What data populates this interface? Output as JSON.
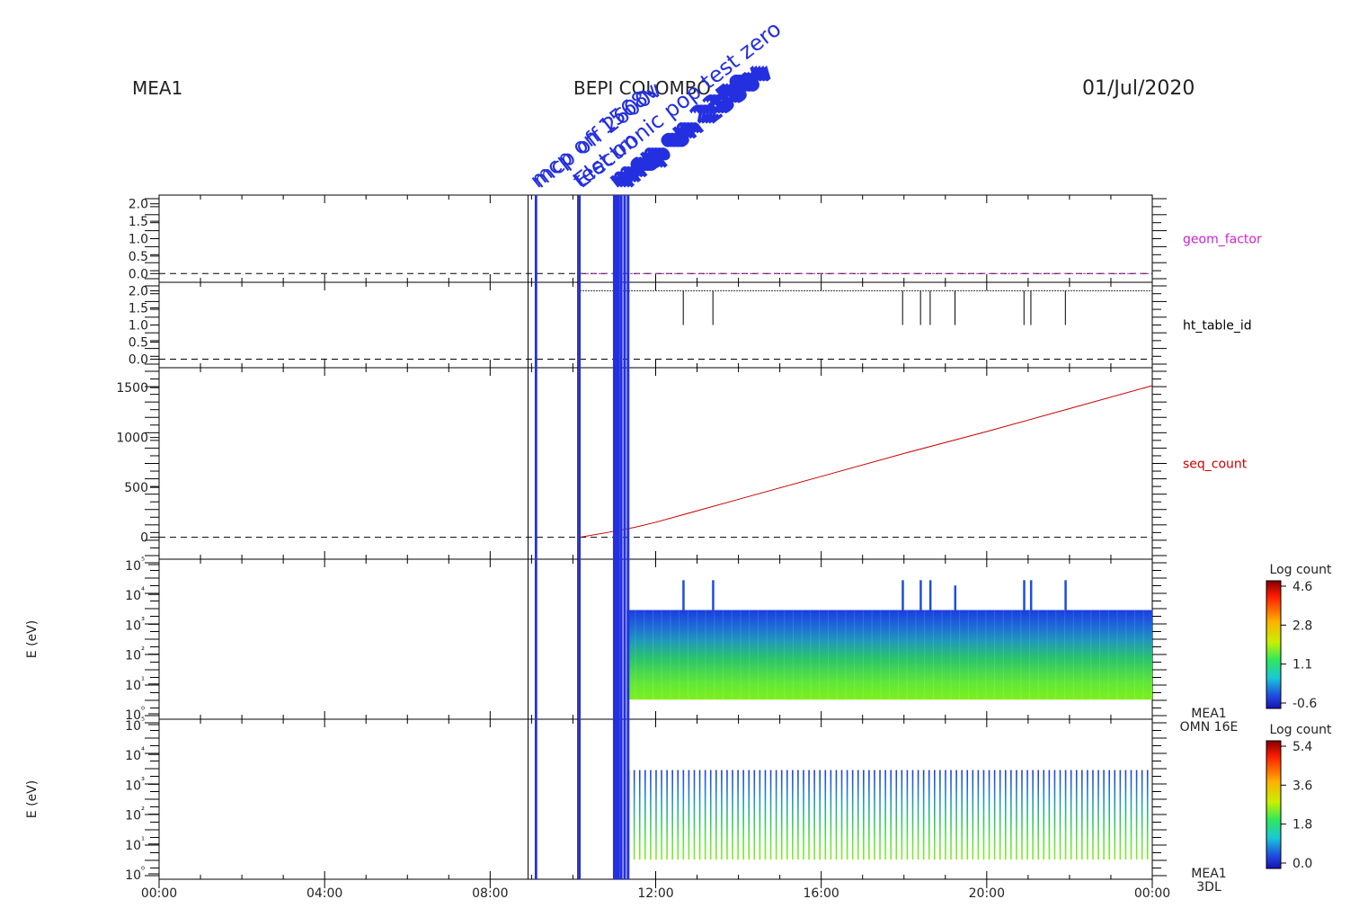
{
  "header": {
    "left": "MEA1",
    "center": "BEPI COLOMBO",
    "right": "01/Jul/2020"
  },
  "annotations": {
    "color": "#2430e0",
    "items": [
      {
        "time": "09:06",
        "text": "mcp on 1568v"
      },
      {
        "time": "09:10",
        "text": "mcp off 2600v"
      },
      {
        "time": "10:08",
        "text": "test on"
      },
      {
        "time": "10:10",
        "text": "Electronic pop test zero"
      },
      {
        "time": "11:00",
        "text": "mcp on 2350v"
      },
      {
        "time": "11:05",
        "text": "mcp on 2350v"
      },
      {
        "time": "11:10",
        "text": "mcp on 2350v"
      },
      {
        "time": "11:15",
        "text": "mcp on 2350v"
      },
      {
        "time": "11:20",
        "text": "mcp on 2350v"
      }
    ],
    "event_times": [
      "09:06",
      "09:07",
      "10:09",
      "10:10",
      "11:00",
      "11:03",
      "11:06",
      "11:10",
      "11:15",
      "11:20"
    ]
  },
  "chart_data": [
    {
      "type": "line",
      "label": "geom_factor",
      "label_color": "#d020d0",
      "ylim": [
        -0.25,
        2.25
      ],
      "yticks": [
        "0.0",
        "0.5",
        "1.0",
        "1.5",
        "2.0"
      ],
      "zero_line": true,
      "series": [
        {
          "x": [
            "10:10",
            "00:00"
          ],
          "values": [
            0.0,
            0.0
          ],
          "color": "#d020d0",
          "style": "dashed"
        }
      ]
    },
    {
      "type": "line",
      "label": "ht_table_id",
      "label_color": "#000000",
      "ylim": [
        -0.25,
        2.25
      ],
      "yticks": [
        "0.0",
        "0.5",
        "1.0",
        "1.5",
        "2.0"
      ],
      "zero_line": true,
      "baseline": {
        "x": [
          "10:10",
          "00:00"
        ],
        "value": 2.0
      },
      "drops": [
        {
          "time": "12:40",
          "value": 1.0
        },
        {
          "time": "13:23",
          "value": 1.0
        },
        {
          "time": "17:58",
          "value": 1.0
        },
        {
          "time": "18:24",
          "value": 1.0
        },
        {
          "time": "18:38",
          "value": 1.0
        },
        {
          "time": "19:14",
          "value": 1.0
        },
        {
          "time": "20:54",
          "value": 1.0
        },
        {
          "time": "21:04",
          "value": 1.0
        },
        {
          "time": "21:54",
          "value": 1.0
        }
      ]
    },
    {
      "type": "line",
      "label": "seq_count",
      "label_color": "#cc0000",
      "ylim": [
        -220,
        1700
      ],
      "yticks": [
        "0",
        "500",
        "1000",
        "1500"
      ],
      "zero_line": true,
      "series": [
        {
          "x": [
            "10:10",
            "11:00",
            "11:30",
            "12:00",
            "14:00",
            "16:00",
            "18:00",
            "20:00",
            "22:00",
            "00:00"
          ],
          "values": [
            0,
            60,
            100,
            150,
            380,
            610,
            840,
            1060,
            1290,
            1520
          ],
          "color": "#cc0000"
        }
      ]
    },
    {
      "type": "heatmap",
      "label": [
        "MEA1",
        "OMN 16E"
      ],
      "ylabel": "E (eV)",
      "yscale": "log",
      "yticks": [
        "10⁰",
        "10¹",
        "10²",
        "10³",
        "10⁴",
        "10⁵"
      ],
      "energy_range": [
        3,
        3000
      ],
      "time_range": [
        "11:18",
        "00:00"
      ],
      "colorbar": {
        "title": "Log count",
        "ticks": [
          "4.6",
          "2.8",
          "1.1",
          "-0.6"
        ]
      },
      "spikes": [
        {
          "time": "12:40",
          "top": 30000
        },
        {
          "time": "13:23",
          "top": 30000
        },
        {
          "time": "17:58",
          "top": 30000
        },
        {
          "time": "18:24",
          "top": 30000
        },
        {
          "time": "18:38",
          "top": 30000
        },
        {
          "time": "19:14",
          "top": 20000
        },
        {
          "time": "20:54",
          "top": 30000
        },
        {
          "time": "21:04",
          "top": 30000
        },
        {
          "time": "21:54",
          "top": 30000
        }
      ]
    },
    {
      "type": "heatmap",
      "label": [
        "MEA1",
        "3DL"
      ],
      "ylabel": "E (eV)",
      "yscale": "log",
      "yticks": [
        "10⁰",
        "10¹",
        "10²",
        "10³",
        "10⁴",
        "10⁵"
      ],
      "energy_range": [
        3,
        3000
      ],
      "time_range": [
        "11:20",
        "00:00"
      ],
      "colorbar": {
        "title": "Log count",
        "ticks": [
          "5.4",
          "3.6",
          "1.8",
          "0.0"
        ]
      },
      "stripe_count": 96
    }
  ],
  "xaxis": {
    "range": [
      "00:00",
      "24:00"
    ],
    "ticks": [
      "00:00",
      "04:00",
      "08:00",
      "12:00",
      "16:00",
      "20:00",
      "00:00"
    ]
  }
}
